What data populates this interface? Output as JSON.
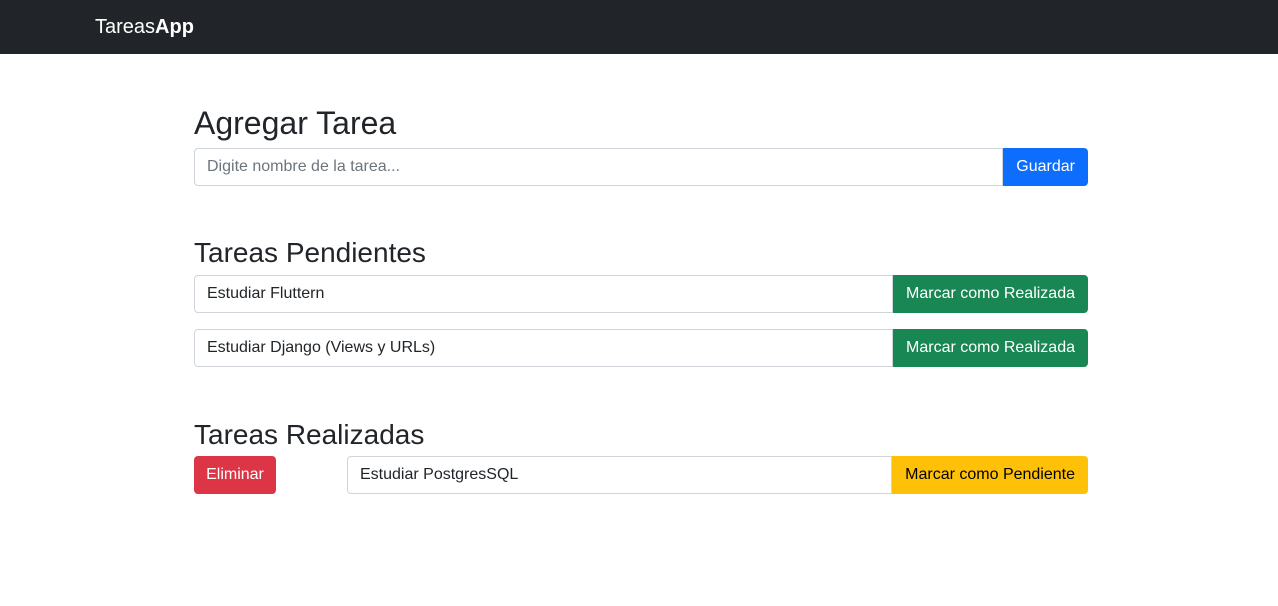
{
  "navbar": {
    "brand_regular": "Tareas",
    "brand_bold": "App"
  },
  "add_section": {
    "title": "Agregar Tarea",
    "input_placeholder": "Digite nombre de la tarea...",
    "input_value": "",
    "save_label": "Guardar"
  },
  "pending_section": {
    "title": "Tareas Pendientes",
    "tasks": [
      {
        "name": "Estudiar Fluttern",
        "action_label": "Marcar como Realizada"
      },
      {
        "name": "Estudiar Django (Views y URLs)",
        "action_label": "Marcar como Realizada"
      }
    ]
  },
  "done_section": {
    "title": "Tareas Realizadas",
    "tasks": [
      {
        "name": "Estudiar PostgresSQL",
        "delete_label": "Eliminar",
        "action_label": "Marcar como Pendiente"
      }
    ]
  },
  "colors": {
    "navbar": "#212529",
    "primary": "#0d6efd",
    "success": "#198754",
    "warning": "#ffc107",
    "danger": "#dc3545"
  }
}
